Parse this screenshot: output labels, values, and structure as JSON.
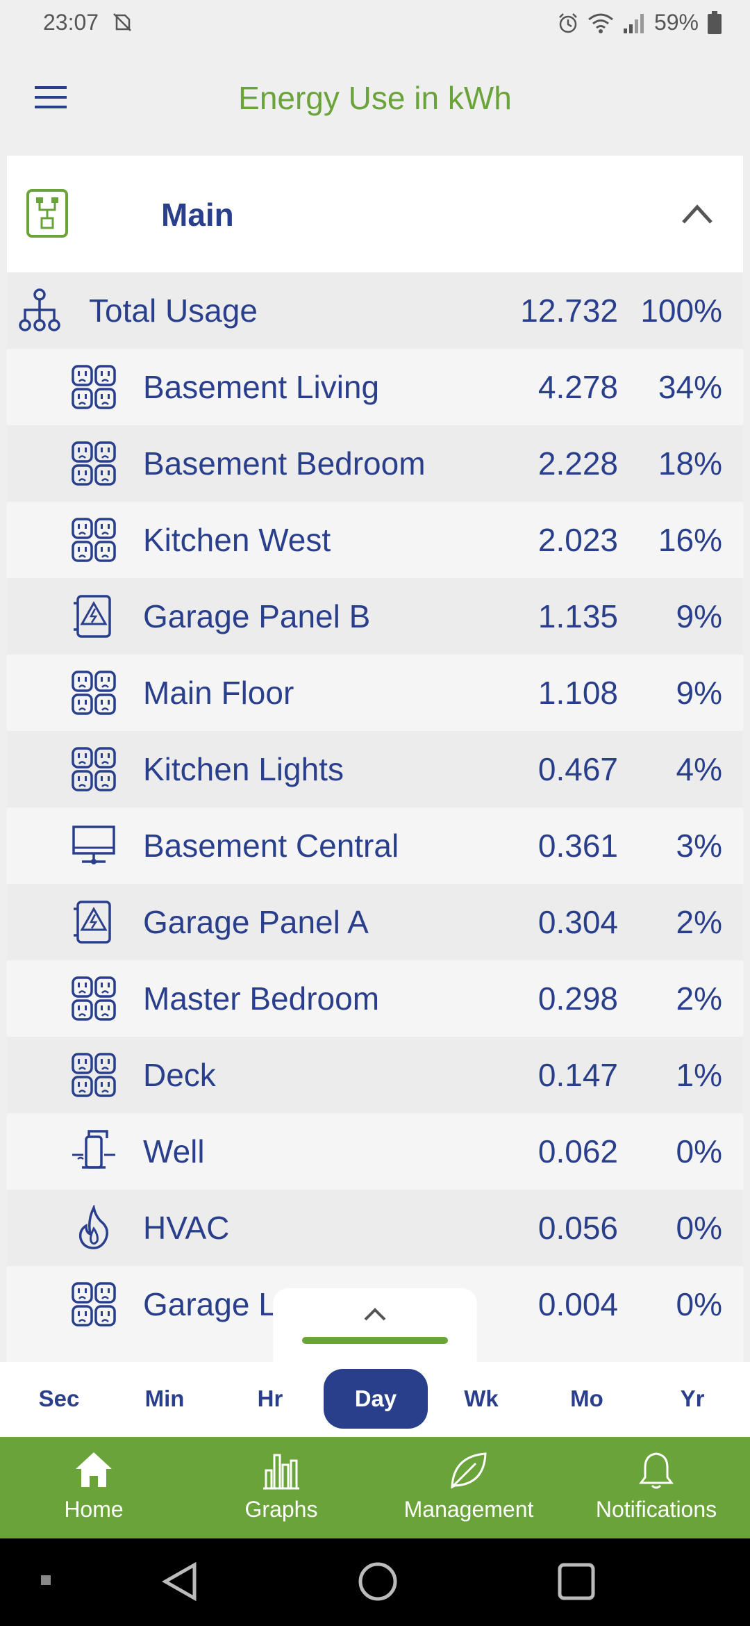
{
  "status_bar": {
    "time": "23:07",
    "battery": "59%"
  },
  "app_bar": {
    "title": "Energy Use in kWh"
  },
  "card": {
    "title": "Main",
    "rows": [
      {
        "name": "Total Usage",
        "kwh": "12.732",
        "pct": "100%",
        "icon": "tree-icon"
      },
      {
        "name": "Basement Living",
        "kwh": "4.278",
        "pct": "34%",
        "icon": "outlet-icon"
      },
      {
        "name": "Basement Bedroom",
        "kwh": "2.228",
        "pct": "18%",
        "icon": "outlet-icon"
      },
      {
        "name": "Kitchen West",
        "kwh": "2.023",
        "pct": "16%",
        "icon": "outlet-icon"
      },
      {
        "name": "Garage Panel B",
        "kwh": "1.135",
        "pct": "9%",
        "icon": "subpanel-icon"
      },
      {
        "name": "Main Floor",
        "kwh": "1.108",
        "pct": "9%",
        "icon": "outlet-icon"
      },
      {
        "name": "Kitchen Lights",
        "kwh": "0.467",
        "pct": "4%",
        "icon": "outlet-icon"
      },
      {
        "name": "Basement Central",
        "kwh": "0.361",
        "pct": "3%",
        "icon": "computer-icon"
      },
      {
        "name": "Garage Panel A",
        "kwh": "0.304",
        "pct": "2%",
        "icon": "subpanel-icon"
      },
      {
        "name": "Master Bedroom",
        "kwh": "0.298",
        "pct": "2%",
        "icon": "outlet-icon"
      },
      {
        "name": "Deck",
        "kwh": "0.147",
        "pct": "1%",
        "icon": "outlet-icon"
      },
      {
        "name": "Well",
        "kwh": "0.062",
        "pct": "0%",
        "icon": "well-pump-icon"
      },
      {
        "name": "HVAC",
        "kwh": "0.056",
        "pct": "0%",
        "icon": "flame-icon"
      },
      {
        "name": "Garage L",
        "kwh": "0.004",
        "pct": "0%",
        "icon": "outlet-icon"
      }
    ]
  },
  "range_selector": {
    "options": [
      "Sec",
      "Min",
      "Hr",
      "Day",
      "Wk",
      "Mo",
      "Yr"
    ],
    "selected": "Day"
  },
  "bottom_nav": {
    "items": [
      {
        "label": "Home",
        "icon": "home-icon"
      },
      {
        "label": "Graphs",
        "icon": "bar-chart-icon"
      },
      {
        "label": "Management",
        "icon": "leaf-icon"
      },
      {
        "label": "Notifications",
        "icon": "bell-icon"
      }
    ]
  },
  "colors": {
    "accent_green": "#6aa33a",
    "navy": "#2a3f8c"
  }
}
